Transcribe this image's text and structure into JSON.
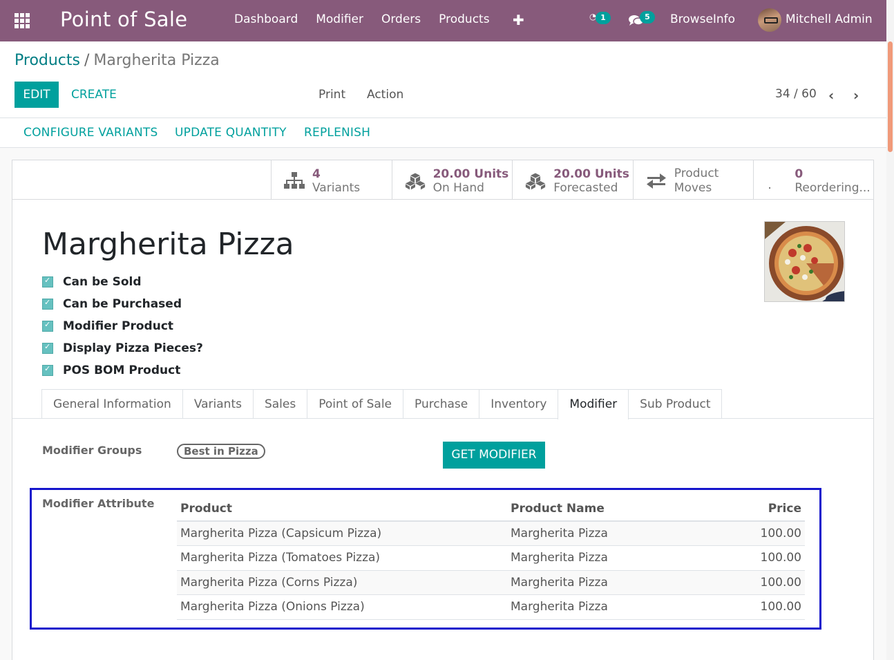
{
  "navbar": {
    "brand": "Point of Sale",
    "menu": [
      "Dashboard",
      "Modifier",
      "Orders",
      "Products"
    ],
    "activity_count": "1",
    "messages_count": "5",
    "company": "BrowseInfo",
    "user": "Mitchell Admin"
  },
  "breadcrumb": {
    "parent": "Products",
    "separator": "/",
    "current": "Margherita Pizza"
  },
  "actions": {
    "edit": "EDIT",
    "create": "CREATE",
    "print": "Print",
    "action": "Action"
  },
  "pager": {
    "value": "34 / 60"
  },
  "statusbar": {
    "configure_variants": "CONFIGURE VARIANTS",
    "update_quantity": "UPDATE QUANTITY",
    "replenish": "REPLENISH"
  },
  "stats": {
    "variants_value": "4",
    "variants_label": "Variants",
    "onhand_value": "20.00 Units",
    "onhand_label": "On Hand",
    "forecast_value": "20.00 Units",
    "forecast_label": "Forecasted",
    "moves_line1": "Product",
    "moves_line2": "Moves",
    "reorder_value": "0",
    "reorder_label": "Reordering..."
  },
  "product": {
    "name": "Margherita Pizza",
    "checks": [
      "Can be Sold",
      "Can be Purchased",
      "Modifier Product",
      "Display Pizza Pieces?",
      "POS BOM Product"
    ]
  },
  "tabs": [
    "General Information",
    "Variants",
    "Sales",
    "Point of Sale",
    "Purchase",
    "Inventory",
    "Modifier",
    "Sub Product"
  ],
  "active_tab": "Modifier",
  "modifier": {
    "groups_label": "Modifier Groups",
    "group_tag": "Best in Pizza",
    "get_modifier": "GET MODIFIER",
    "attribute_label": "Modifier Attribute",
    "columns": [
      "Product",
      "Product Name",
      "Price"
    ],
    "rows": [
      [
        "Margherita Pizza (Capsicum Pizza)",
        "Margherita Pizza",
        "100.00"
      ],
      [
        "Margherita Pizza (Tomatoes Pizza)",
        "Margherita Pizza",
        "100.00"
      ],
      [
        "Margherita Pizza (Corns Pizza)",
        "Margherita Pizza",
        "100.00"
      ],
      [
        "Margherita Pizza (Onions Pizza)",
        "Margherita Pizza",
        "100.00"
      ]
    ]
  },
  "colors": {
    "navbar": "#875a7b",
    "primary": "#00a09d",
    "link": "#017e84",
    "highlight": "#1515cc"
  }
}
